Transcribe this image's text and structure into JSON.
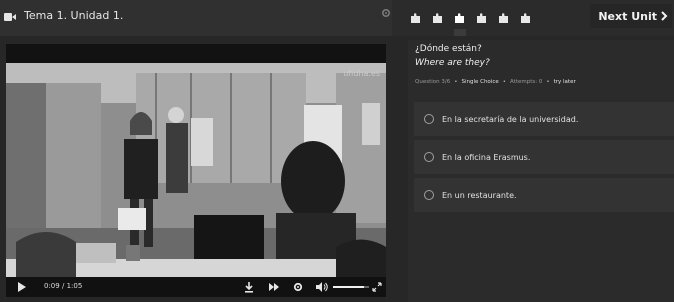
{
  "header": {
    "lesson_title": "Tema 1. Unidad 1.",
    "next_unit_label": "Next Unit",
    "steps": [
      "step-1",
      "step-2",
      "step-3",
      "step-4",
      "step-5",
      "step-6"
    ],
    "current_step": 3
  },
  "video": {
    "watermark": "ufidha.es",
    "time_current": "0:09",
    "time_separator": "/",
    "time_total": "1:05",
    "volume_level": 0.85
  },
  "question": {
    "prompt_es": "¿Dónde están?",
    "prompt_en": "Where are they?",
    "meta": {
      "question_label": "Question 3/6",
      "type_label": "Single Choice",
      "attempts_label": "Attempts: 0",
      "try_later_label": "try later"
    },
    "options": [
      {
        "label": "En la secretaría de la universidad."
      },
      {
        "label": "En la oficina Erasmus."
      },
      {
        "label": "En un restaurante."
      }
    ]
  },
  "colors": {
    "background": "#272727",
    "panel": "#2b2b2b",
    "option_bg": "#333333",
    "text": "#e2e2e2"
  }
}
